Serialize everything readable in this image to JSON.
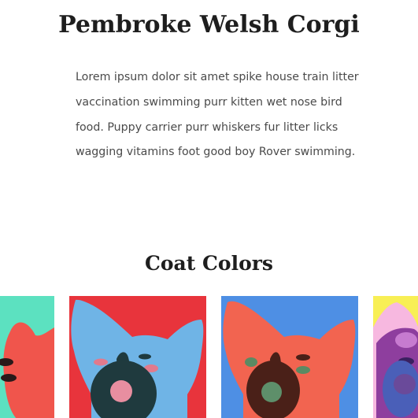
{
  "article": {
    "title": "Pembroke Welsh Corgi",
    "intro": "Lorem ipsum dolor sit amet spike house train litter vaccination swimming purr kitten wet nose bird food. Puppy carrier purr whiskers fur litter licks wagging vitamins foot good boy Rover swimming."
  },
  "coat_colors": {
    "heading": "Coat Colors",
    "tiles": [
      {
        "icon": "corgi-face-icon",
        "background": "#5ce1c0",
        "face": "#f0554c",
        "accent": "#2a1a1a"
      },
      {
        "icon": "corgi-face-icon",
        "background": "#e8343c",
        "face": "#6fb4e6",
        "accent": "#1f3a3e"
      },
      {
        "icon": "corgi-face-icon",
        "background": "#4e8fe4",
        "face": "#f26450",
        "accent": "#4a2018"
      },
      {
        "icon": "corgi-face-icon",
        "background": "#f8ef55",
        "face": "#8e3e9e",
        "accent": "#3a2060"
      }
    ]
  }
}
